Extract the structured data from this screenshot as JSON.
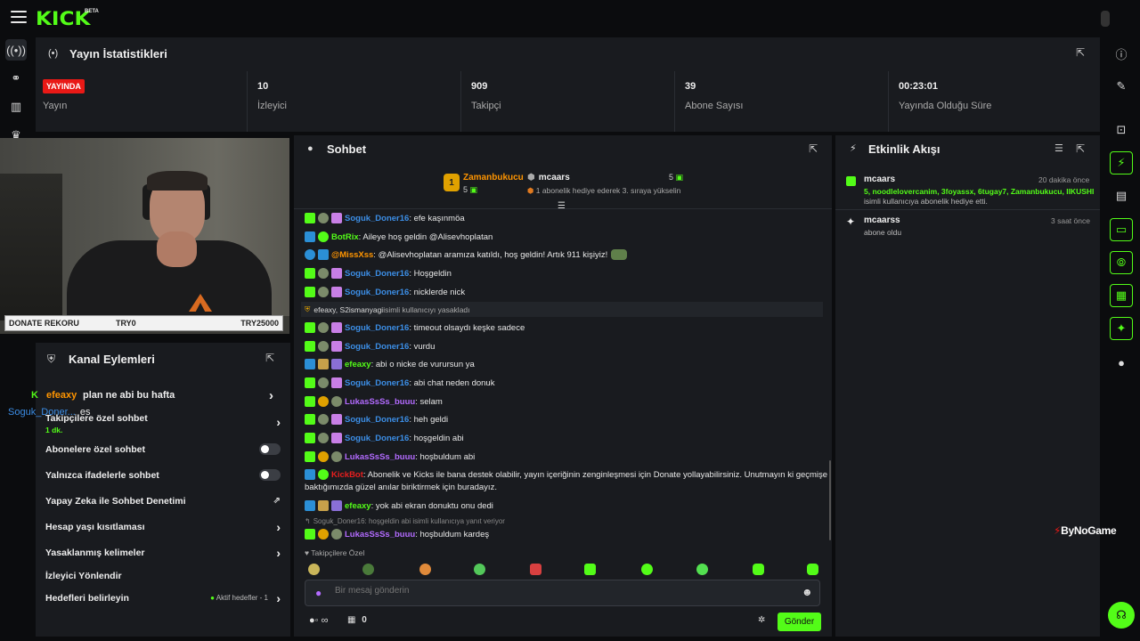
{
  "brand": {
    "logo": "KICK",
    "beta": "BETA"
  },
  "stats_panel": {
    "title": "Yayın İstatistikleri",
    "live_badge": "YAYINDA",
    "items": [
      {
        "value": "",
        "label": "Yayın"
      },
      {
        "value": "10",
        "label": "İzleyici"
      },
      {
        "value": "909",
        "label": "Takipçi"
      },
      {
        "value": "39",
        "label": "Abone Sayısı"
      },
      {
        "value": "00:23:01",
        "label": "Yayında Olduğu Süre"
      }
    ]
  },
  "donate": {
    "label": "DONATE REKORU",
    "min": "TRY0",
    "max": "TRY25000"
  },
  "overlay": {
    "line1_user": "efeaxy",
    "line1_text": "plan ne abi bu hafta",
    "line2_user": "Soguk_Doner...",
    "line2_text": "es"
  },
  "kanal": {
    "title": "Kanal Eylemleri",
    "followers_only": "Takipçilere özel sohbet",
    "followers_time": "1 dk.",
    "subs_only": "Abonelere özel sohbet",
    "emotes_only": "Yalnızca ifadelerle sohbet",
    "ai_mod": "Yapay Zeka ile Sohbet Denetimi",
    "account_age": "Hesap yaşı kısıtlaması",
    "banned_words": "Yasaklanmış kelimeler",
    "viewer_redirect": "İzleyici Yönlendir",
    "goals": "Hedefleri belirleyin",
    "goals_status": "Aktif hedefler - 1"
  },
  "chat": {
    "title": "Sohbet",
    "pinned": {
      "rank": "1",
      "user1": "Zamanbukucu",
      "count1": "5",
      "user2": "mcaars",
      "count2": "5",
      "sub_text": "1 abonelik hediye ederek 3. sıraya yükselin"
    },
    "messages": [
      {
        "user": "Soguk_Doner16",
        "text": ": efe kaşınmöa"
      },
      {
        "user": "BotRix",
        "text": ": Aileye hoş geldin @Alisevhoplatan"
      },
      {
        "user": "@MissXss",
        "text": ": @Alisevhoplatan aramıza katıldı, hoş geldin! Artık 911 kişiyiz!"
      },
      {
        "user": "Soguk_Doner16",
        "text": ": Hoşgeldin"
      },
      {
        "user": "Soguk_Doner16",
        "text": ": nicklerde nick"
      },
      {
        "user": "efeaxy, S2ismanyagi",
        "text": " isimli kullanıcıyı yasakladı"
      },
      {
        "user": "Soguk_Doner16",
        "text": ": timeout olsaydı keşke sadece"
      },
      {
        "user": "Soguk_Doner16",
        "text": ": vurdu"
      },
      {
        "user": "efeaxy",
        "text": ": abi o nicke de vurursun ya"
      },
      {
        "user": "Soguk_Doner16",
        "text": ": abi chat neden donuk"
      },
      {
        "user": "LukasSsSs_buuu",
        "text": ": selam"
      },
      {
        "user": "Soguk_Doner16",
        "text": ": heh geldi"
      },
      {
        "user": "Soguk_Doner16",
        "text": ": hoşgeldin abi"
      },
      {
        "user": "LukasSsSs_buuu",
        "text": ": hoşbuldum abi"
      },
      {
        "user": "KickBot",
        "text": ": Abonelik ve Kicks ile bana destek olabilir, yayın içeriğinin zenginleşmesi için Donate yollayabilirsiniz. Unutmayın ki geçmişe",
        "text2": "baktığımızda güzel anılar biriktirmek için buradayız."
      },
      {
        "user": "efeaxy",
        "text": ": yok abi ekran donuktu onu dedi"
      },
      {
        "user": "",
        "text": "Soguk_Doner16: hoşgeldin abi isimli kullanıcıya yanıt veriyor"
      },
      {
        "user": "LukasSsSs_buuu",
        "text": ": hoşbuldum kardeş"
      }
    ],
    "followers_only": "Takipçilere Özel",
    "input_placeholder": "Bir mesaj gönderin",
    "infinity": "∞",
    "kicks_count": "0",
    "send": "Gönder"
  },
  "activity": {
    "title": "Etkinlik Akışı",
    "items": [
      {
        "user": "mcaars",
        "time": "20 dakika önce",
        "highlight": "5, noodlelovercanim, 3foyassx, 6tugay7, Zamanbukucu, IIKUSHI",
        "text": "isimli kullanıcıya abonelik hediye etti."
      },
      {
        "user": "mcaarss",
        "time": "3 saat önce",
        "text": "abone oldu"
      }
    ]
  },
  "watermark": "ByNoGame",
  "colors": {
    "accent": "#53fc18",
    "panel": "#191b1f",
    "live": "#e91916"
  }
}
